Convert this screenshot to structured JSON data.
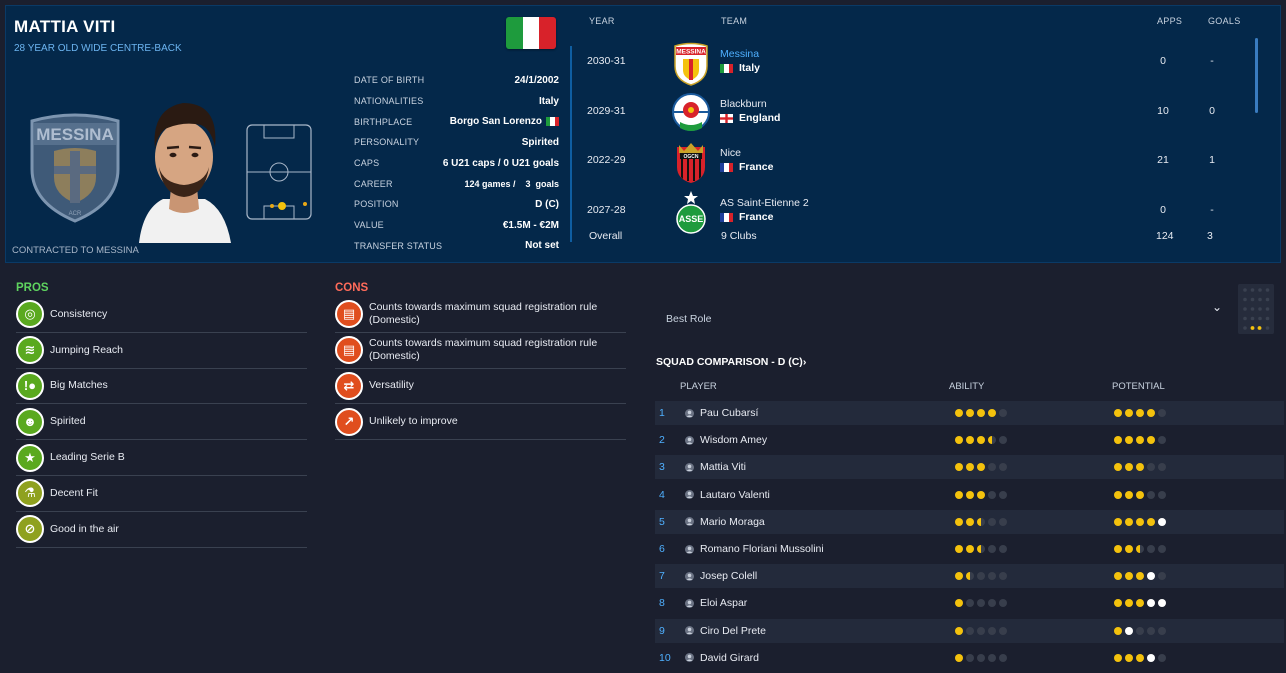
{
  "player": {
    "name": "MATTIA VITI",
    "subtitle": "28 YEAR OLD WIDE CENTRE-BACK",
    "contracted": "CONTRACTED TO MESSINA",
    "club_crest_text": "MESSINA",
    "club_crest_subtext": "ACR"
  },
  "info": [
    {
      "label": "DATE OF BIRTH",
      "value": "24/1/2002"
    },
    {
      "label": "NATIONALITIES",
      "value": "Italy"
    },
    {
      "label": "BIRTHPLACE",
      "value": "Borgo San Lorenzo"
    },
    {
      "label": "PERSONALITY",
      "value": "Spirited"
    },
    {
      "label": "CAPS",
      "value": "6 U21 caps / 0 U21 goals"
    },
    {
      "label": "CAREER",
      "value": "124 games /    3  goals"
    },
    {
      "label": "POSITION",
      "value": "D (C)"
    },
    {
      "label": "VALUE",
      "value": "€1.5M - €2M"
    },
    {
      "label": "TRANSFER STATUS",
      "value": "Not set"
    }
  ],
  "career": {
    "headers": {
      "year": "YEAR",
      "team": "TEAM",
      "apps": "APPS",
      "goals": "GOALS"
    },
    "rows": [
      {
        "year": "2030-31",
        "team": "Messina",
        "nation": "Italy",
        "apps": "0",
        "goals": "-",
        "badge": "messina-badge"
      },
      {
        "year": "2029-31",
        "team": "Blackburn",
        "nation": "England",
        "apps": "10",
        "goals": "0",
        "badge": "blackburn-badge"
      },
      {
        "year": "2022-29",
        "team": "Nice",
        "nation": "France",
        "apps": "21",
        "goals": "1",
        "badge": "nice-badge"
      },
      {
        "year": "2027-28",
        "team": "AS Saint-Etienne 2",
        "nation": "France",
        "apps": "0",
        "goals": "-",
        "badge": "saint-etienne-badge"
      }
    ],
    "overall": {
      "label": "Overall",
      "clubs": "9 Clubs",
      "apps": "124",
      "goals": "3"
    }
  },
  "pros": {
    "title": "PROS",
    "items": [
      {
        "label": "Consistency",
        "icon": "target-icon"
      },
      {
        "label": "Jumping Reach",
        "icon": "spring-icon"
      },
      {
        "label": "Big Matches",
        "icon": "ball-icon"
      },
      {
        "label": "Spirited",
        "icon": "head-icon"
      },
      {
        "label": "Leading Serie B",
        "icon": "star-icon"
      },
      {
        "label": "Decent Fit",
        "icon": "flask-icon"
      },
      {
        "label": "Good in the air",
        "icon": "bandage-icon"
      }
    ]
  },
  "cons": {
    "title": "CONS",
    "items": [
      {
        "label": "Counts towards maximum squad registration rule (Domestic)",
        "icon": "document-icon"
      },
      {
        "label": "Counts towards maximum squad registration rule (Domestic)",
        "icon": "document-icon"
      },
      {
        "label": "Versatility",
        "icon": "arrows-icon"
      },
      {
        "label": "Unlikely to improve",
        "icon": "trend-icon"
      }
    ]
  },
  "squad": {
    "best_role_label": "Best Role",
    "title": "SQUAD COMPARISON - D (C)",
    "headers": {
      "player": "PLAYER",
      "ability": "ABILITY",
      "potential": "POTENTIAL"
    },
    "rows": [
      {
        "rank": "1",
        "name": "Pau Cubarsí",
        "ability": 4,
        "potential": 4
      },
      {
        "rank": "2",
        "name": "Wisdom Amey",
        "ability": 3.5,
        "potential": 4
      },
      {
        "rank": "3",
        "name": "Mattia Viti",
        "ability": 3,
        "potential": 3
      },
      {
        "rank": "4",
        "name": "Lautaro Valenti",
        "ability": 3,
        "potential": 3
      },
      {
        "rank": "5",
        "name": "Mario Moraga",
        "ability": 2.5,
        "potential": 5
      },
      {
        "rank": "6",
        "name": "Romano Floriani Mussolini",
        "ability": 2.5,
        "potential": 2.5
      },
      {
        "rank": "7",
        "name": "Josep Colell",
        "ability": 1.5,
        "potential": 4
      },
      {
        "rank": "8",
        "name": "Eloi Aspar",
        "ability": 1,
        "potential": 4.5
      },
      {
        "rank": "9",
        "name": "Ciro Del Prete",
        "ability": 1,
        "potential": 2
      },
      {
        "rank": "10",
        "name": "David Girard",
        "ability": 1,
        "potential": 4
      }
    ]
  },
  "colors": {
    "header_bg": "#04284a",
    "page_bg": "#1b1f2e",
    "pros_title": "#5fd45f",
    "cons_title": "#ff6b5a",
    "pros_icon": "#5aa91f",
    "cons_icon": "#e04e1e",
    "link": "#4fb0ff",
    "star": "#f4c20d"
  }
}
